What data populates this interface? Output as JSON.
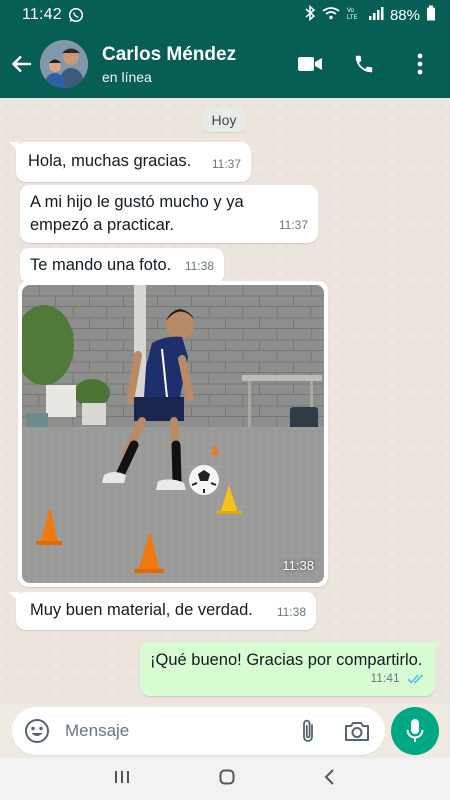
{
  "status_bar": {
    "time": "11:42",
    "battery": "88%"
  },
  "header": {
    "contact_name": "Carlos Méndez",
    "contact_status": "en línea"
  },
  "chat": {
    "day_label": "Hoy",
    "messages": [
      {
        "text": "Hola, muchas gracias.",
        "time": "11:37"
      },
      {
        "text": "A mi hijo le gustó mucho y ya empezó a practicar.",
        "time": "11:37"
      },
      {
        "text": "Te mando una foto.",
        "time": "11:38"
      },
      {
        "photo_time": "11:38"
      },
      {
        "text": "Muy buen material, de verdad.",
        "time": "11:38"
      },
      {
        "text": "¡Qué bueno! Gracias por compartirlo.",
        "time": "11:41"
      }
    ]
  },
  "input": {
    "placeholder": "Mensaje"
  },
  "colors": {
    "header": "#075e54",
    "outgoing_bubble": "#d9fdd3",
    "accent": "#00a884",
    "read_ticks": "#53bdeb"
  },
  "icons": [
    "back-arrow-icon",
    "video-call-icon",
    "phone-icon",
    "more-vert-icon",
    "emoji-icon",
    "attach-icon",
    "camera-icon",
    "mic-icon",
    "whatsapp-icon",
    "bluetooth-icon",
    "wifi-icon",
    "signal-icon",
    "battery-icon"
  ]
}
